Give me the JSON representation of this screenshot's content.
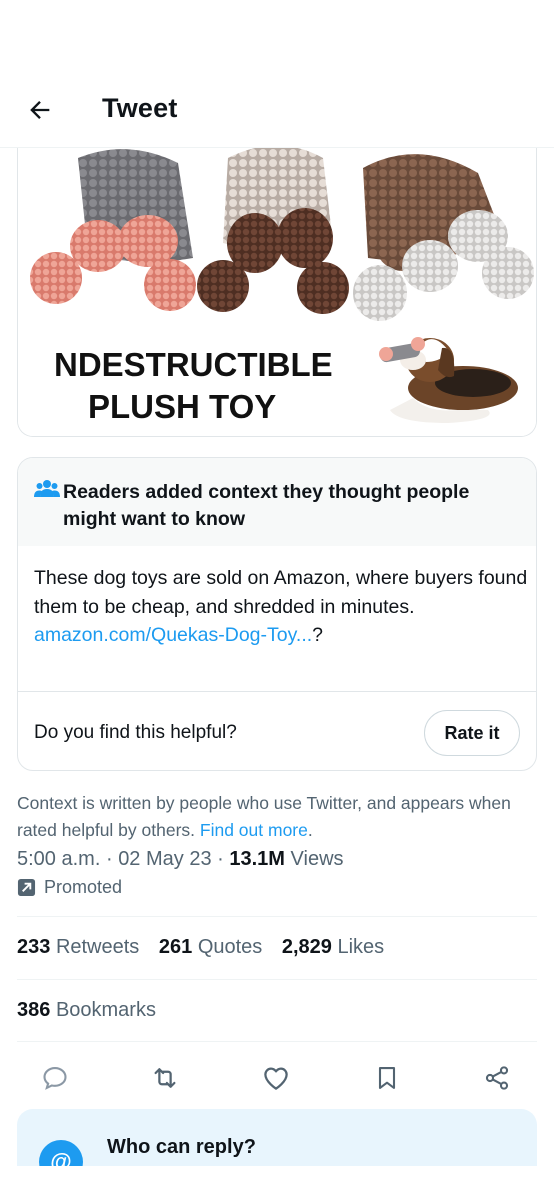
{
  "header": {
    "title": "Tweet",
    "back_icon": "arrow-left-icon"
  },
  "media": {
    "image_caption_line1": "NDESTRUCTIBLE",
    "image_caption_line2": "PLUSH TOY"
  },
  "community_note": {
    "icon": "people-icon",
    "heading": "Readers added context they thought people might want to know",
    "body": "These dog toys are sold on Amazon, where buyers found them to be cheap, and shredded in minutes.",
    "link_text": "amazon.com/Quekas-Dog-Toy...",
    "link_suffix": "?",
    "question": "Do you find this helpful?",
    "rate_button": "Rate it"
  },
  "context_note": {
    "text": "Context is written by people who use Twitter, and appears when rated helpful by others.",
    "link": "Find out more",
    "suffix": "."
  },
  "meta": {
    "time": "5:00 a.m.",
    "sep1": "·",
    "date": "02 May 23",
    "sep2": "·",
    "views_count": "13.1M",
    "views_label": "Views",
    "promoted": "Promoted"
  },
  "stats": {
    "retweets_count": "233",
    "retweets_label": "Retweets",
    "quotes_count": "261",
    "quotes_label": "Quotes",
    "likes_count": "2,829",
    "likes_label": "Likes",
    "bookmarks_count": "386",
    "bookmarks_label": "Bookmarks"
  },
  "actions": [
    "reply-icon",
    "retweet-icon",
    "like-icon",
    "bookmark-icon",
    "share-icon"
  ],
  "reply": {
    "title": "Who can reply?",
    "avatar_glyph": "@"
  },
  "colors": {
    "accent": "#1d9bf0",
    "text": "#0f1419",
    "secondary": "#536471",
    "border": "#e1e6e9",
    "reply_bg": "#e8f5fd"
  }
}
